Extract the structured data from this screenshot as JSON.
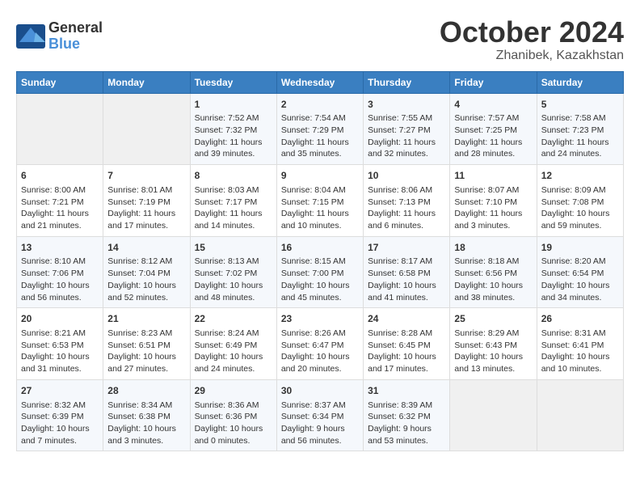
{
  "header": {
    "logo": {
      "line1": "General",
      "line2": "Blue"
    },
    "month": "October 2024",
    "location": "Zhanibek, Kazakhstan"
  },
  "weekdays": [
    "Sunday",
    "Monday",
    "Tuesday",
    "Wednesday",
    "Thursday",
    "Friday",
    "Saturday"
  ],
  "weeks": [
    [
      {
        "day": "",
        "sunrise": "",
        "sunset": "",
        "daylight": ""
      },
      {
        "day": "",
        "sunrise": "",
        "sunset": "",
        "daylight": ""
      },
      {
        "day": "1",
        "sunrise": "Sunrise: 7:52 AM",
        "sunset": "Sunset: 7:32 PM",
        "daylight": "Daylight: 11 hours and 39 minutes."
      },
      {
        "day": "2",
        "sunrise": "Sunrise: 7:54 AM",
        "sunset": "Sunset: 7:29 PM",
        "daylight": "Daylight: 11 hours and 35 minutes."
      },
      {
        "day": "3",
        "sunrise": "Sunrise: 7:55 AM",
        "sunset": "Sunset: 7:27 PM",
        "daylight": "Daylight: 11 hours and 32 minutes."
      },
      {
        "day": "4",
        "sunrise": "Sunrise: 7:57 AM",
        "sunset": "Sunset: 7:25 PM",
        "daylight": "Daylight: 11 hours and 28 minutes."
      },
      {
        "day": "5",
        "sunrise": "Sunrise: 7:58 AM",
        "sunset": "Sunset: 7:23 PM",
        "daylight": "Daylight: 11 hours and 24 minutes."
      }
    ],
    [
      {
        "day": "6",
        "sunrise": "Sunrise: 8:00 AM",
        "sunset": "Sunset: 7:21 PM",
        "daylight": "Daylight: 11 hours and 21 minutes."
      },
      {
        "day": "7",
        "sunrise": "Sunrise: 8:01 AM",
        "sunset": "Sunset: 7:19 PM",
        "daylight": "Daylight: 11 hours and 17 minutes."
      },
      {
        "day": "8",
        "sunrise": "Sunrise: 8:03 AM",
        "sunset": "Sunset: 7:17 PM",
        "daylight": "Daylight: 11 hours and 14 minutes."
      },
      {
        "day": "9",
        "sunrise": "Sunrise: 8:04 AM",
        "sunset": "Sunset: 7:15 PM",
        "daylight": "Daylight: 11 hours and 10 minutes."
      },
      {
        "day": "10",
        "sunrise": "Sunrise: 8:06 AM",
        "sunset": "Sunset: 7:13 PM",
        "daylight": "Daylight: 11 hours and 6 minutes."
      },
      {
        "day": "11",
        "sunrise": "Sunrise: 8:07 AM",
        "sunset": "Sunset: 7:10 PM",
        "daylight": "Daylight: 11 hours and 3 minutes."
      },
      {
        "day": "12",
        "sunrise": "Sunrise: 8:09 AM",
        "sunset": "Sunset: 7:08 PM",
        "daylight": "Daylight: 10 hours and 59 minutes."
      }
    ],
    [
      {
        "day": "13",
        "sunrise": "Sunrise: 8:10 AM",
        "sunset": "Sunset: 7:06 PM",
        "daylight": "Daylight: 10 hours and 56 minutes."
      },
      {
        "day": "14",
        "sunrise": "Sunrise: 8:12 AM",
        "sunset": "Sunset: 7:04 PM",
        "daylight": "Daylight: 10 hours and 52 minutes."
      },
      {
        "day": "15",
        "sunrise": "Sunrise: 8:13 AM",
        "sunset": "Sunset: 7:02 PM",
        "daylight": "Daylight: 10 hours and 48 minutes."
      },
      {
        "day": "16",
        "sunrise": "Sunrise: 8:15 AM",
        "sunset": "Sunset: 7:00 PM",
        "daylight": "Daylight: 10 hours and 45 minutes."
      },
      {
        "day": "17",
        "sunrise": "Sunrise: 8:17 AM",
        "sunset": "Sunset: 6:58 PM",
        "daylight": "Daylight: 10 hours and 41 minutes."
      },
      {
        "day": "18",
        "sunrise": "Sunrise: 8:18 AM",
        "sunset": "Sunset: 6:56 PM",
        "daylight": "Daylight: 10 hours and 38 minutes."
      },
      {
        "day": "19",
        "sunrise": "Sunrise: 8:20 AM",
        "sunset": "Sunset: 6:54 PM",
        "daylight": "Daylight: 10 hours and 34 minutes."
      }
    ],
    [
      {
        "day": "20",
        "sunrise": "Sunrise: 8:21 AM",
        "sunset": "Sunset: 6:53 PM",
        "daylight": "Daylight: 10 hours and 31 minutes."
      },
      {
        "day": "21",
        "sunrise": "Sunrise: 8:23 AM",
        "sunset": "Sunset: 6:51 PM",
        "daylight": "Daylight: 10 hours and 27 minutes."
      },
      {
        "day": "22",
        "sunrise": "Sunrise: 8:24 AM",
        "sunset": "Sunset: 6:49 PM",
        "daylight": "Daylight: 10 hours and 24 minutes."
      },
      {
        "day": "23",
        "sunrise": "Sunrise: 8:26 AM",
        "sunset": "Sunset: 6:47 PM",
        "daylight": "Daylight: 10 hours and 20 minutes."
      },
      {
        "day": "24",
        "sunrise": "Sunrise: 8:28 AM",
        "sunset": "Sunset: 6:45 PM",
        "daylight": "Daylight: 10 hours and 17 minutes."
      },
      {
        "day": "25",
        "sunrise": "Sunrise: 8:29 AM",
        "sunset": "Sunset: 6:43 PM",
        "daylight": "Daylight: 10 hours and 13 minutes."
      },
      {
        "day": "26",
        "sunrise": "Sunrise: 8:31 AM",
        "sunset": "Sunset: 6:41 PM",
        "daylight": "Daylight: 10 hours and 10 minutes."
      }
    ],
    [
      {
        "day": "27",
        "sunrise": "Sunrise: 8:32 AM",
        "sunset": "Sunset: 6:39 PM",
        "daylight": "Daylight: 10 hours and 7 minutes."
      },
      {
        "day": "28",
        "sunrise": "Sunrise: 8:34 AM",
        "sunset": "Sunset: 6:38 PM",
        "daylight": "Daylight: 10 hours and 3 minutes."
      },
      {
        "day": "29",
        "sunrise": "Sunrise: 8:36 AM",
        "sunset": "Sunset: 6:36 PM",
        "daylight": "Daylight: 10 hours and 0 minutes."
      },
      {
        "day": "30",
        "sunrise": "Sunrise: 8:37 AM",
        "sunset": "Sunset: 6:34 PM",
        "daylight": "Daylight: 9 hours and 56 minutes."
      },
      {
        "day": "31",
        "sunrise": "Sunrise: 8:39 AM",
        "sunset": "Sunset: 6:32 PM",
        "daylight": "Daylight: 9 hours and 53 minutes."
      },
      {
        "day": "",
        "sunrise": "",
        "sunset": "",
        "daylight": ""
      },
      {
        "day": "",
        "sunrise": "",
        "sunset": "",
        "daylight": ""
      }
    ]
  ]
}
